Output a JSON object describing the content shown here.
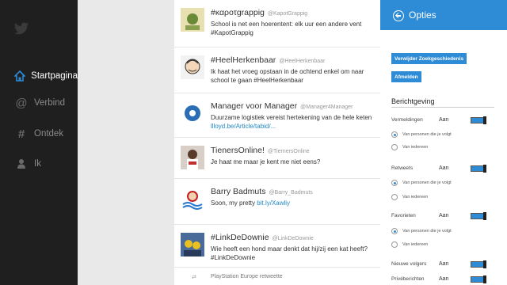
{
  "nav": {
    "items": [
      {
        "label": "Startpagina",
        "icon": "home-icon",
        "active": true
      },
      {
        "label": "Verbind",
        "icon": "at-icon",
        "active": false
      },
      {
        "label": "Ontdek",
        "icon": "hash-icon",
        "active": false
      },
      {
        "label": "Ik",
        "icon": "person-icon",
        "active": false
      }
    ]
  },
  "feed": {
    "tweets": [
      {
        "name": "#καροτgrappig",
        "handle": "@KapotGrappig",
        "text": "School is net een hoerentent: elk uur een andere vent #KapotGrappig",
        "link": ""
      },
      {
        "name": "#HeelHerkenbaar",
        "handle": "@HeelHerkenbaar",
        "text": "Ik haat het vroeg opstaan in de ochtend enkel om naar school te gaan #HeelHerkenbaar",
        "link": ""
      },
      {
        "name": "Manager voor Manager",
        "handle": "@Manager4Manager",
        "text": "Duurzame logistiek vereist hertekening van de hele keten",
        "link": "llloyd.be/Article/tabid/..."
      },
      {
        "name": "TienersOnline!",
        "handle": "@TiernersOnline",
        "text": "Je haat me maar je kent me niet eens?",
        "link": ""
      },
      {
        "name": "Barry Badmuts",
        "handle": "@Barry_Badmuts",
        "text": "Soon, my pretty",
        "link": "bit.ly/Xawliy"
      },
      {
        "name": "#LinkDeDownie",
        "handle": "@LinkDeDownie",
        "text": "Wie heeft een hond maar denkt dat hij/zij een kat heeft? #LinkDeDownie",
        "link": ""
      }
    ],
    "retweet": "PlayStation Europe retweette"
  },
  "options": {
    "title": "Opties",
    "clear_search_label": "Verwijder Zoekgeschiedenis",
    "logout_label": "Afmelden",
    "section_title": "Berichtgeving",
    "rows": [
      {
        "label": "Vermeldingen",
        "state": "Aan",
        "radio_on": "Van personen die je volgt",
        "radio_off": "Van iedereen"
      },
      {
        "label": "Retweets",
        "state": "Aan",
        "radio_on": "Van personen die je volgt",
        "radio_off": "Van iedereen"
      },
      {
        "label": "Favorieten",
        "state": "Aan",
        "radio_on": "Van personen die je volgt",
        "radio_off": "Van iedereen"
      },
      {
        "label": "Nieuwe volgers",
        "state": "Aan"
      },
      {
        "label": "Privéberichten",
        "state": "Aan"
      }
    ]
  },
  "colors": {
    "accent": "#2e8bd6",
    "nav_bg": "#1f1f1f"
  }
}
